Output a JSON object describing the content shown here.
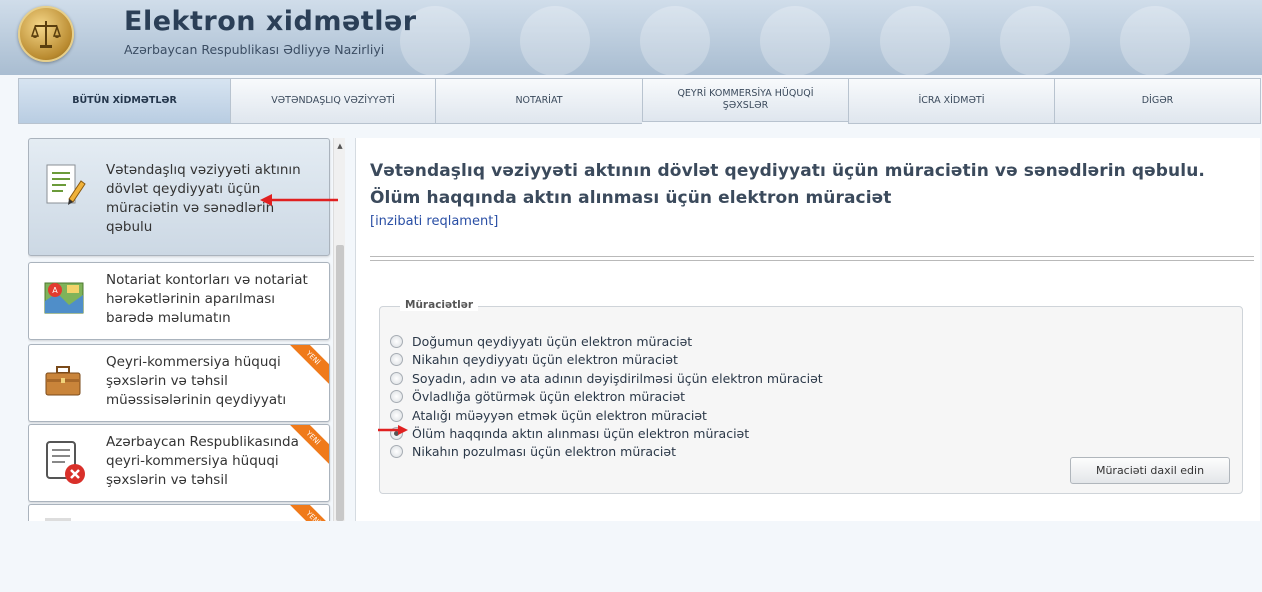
{
  "header": {
    "title": "Elektron xidmətlər",
    "subtitle": "Azərbaycan Respublikası Ədliyyə Nazirliyi"
  },
  "tabs": [
    {
      "label": "BÜTÜN XİDMƏTLƏR",
      "active": true
    },
    {
      "label": "VƏTƏNDAŞLIQ VƏZİYYƏTİ"
    },
    {
      "label": "NOTARİAT"
    },
    {
      "label": "QEYRİ KOMMERSİYA HÜQUQİ ŞƏXSLƏR"
    },
    {
      "label": "İCRA XİDMƏTİ"
    },
    {
      "label": "DİGƏR"
    }
  ],
  "sidebar": {
    "items": [
      {
        "label": "Vətəndaşlıq vəziyyəti aktının dövlət qeydiyyatı üçün müraciətin və sənədlərin qəbulu",
        "icon": "document-edit-icon",
        "active": true
      },
      {
        "label": "Notariat kontorları və notariat hərəkətlərinin aparılması barədə məlumatın",
        "icon": "map-icon"
      },
      {
        "label": "Qeyri-kommersiya hüquqi şəxslərin və təhsil müəssisələrinin qeydiyyatı",
        "icon": "briefcase-icon",
        "badge": "YENİ"
      },
      {
        "label": "Azərbaycan Respublikasında qeyri-kommersiya hüquqi şəxslərin və təhsil",
        "icon": "document-cancel-icon",
        "badge": "YENİ"
      },
      {
        "label": "",
        "icon": "document-icon",
        "badge": "YENİ"
      }
    ]
  },
  "main": {
    "title": "Vətəndaşlıq vəziyyəti aktının dövlət qeydiyyatı üçün müraciətin və sənədlərin qəbulu. Ölüm haqqında aktın alınması üçün elektron müraciət",
    "reglament_link": "[inzibati reqlament]",
    "fieldset_legend": "Müraciətlər",
    "options": [
      "Doğumun qeydiyyatı üçün elektron müraciət",
      "Nikahın qeydiyyatı üçün elektron müraciət",
      "Soyadın, adın və ata adının dəyişdirilməsi üçün elektron müraciət",
      "Övladlığa götürmək üçün elektron müraciət",
      "Atalığı müəyyən etmək üçün elektron müraciət",
      "Ölüm haqqında aktın alınması üçün elektron müraciət",
      "Nikahın pozulması üçün elektron müraciət"
    ],
    "selected_option_index": 5,
    "submit_label": "Müraciəti daxil edin"
  },
  "colors": {
    "header": "#b7c8da",
    "title_text": "#2b3f57",
    "link": "#2a4fa5",
    "arrow": "#e02020",
    "badge": "#f07a1a"
  }
}
